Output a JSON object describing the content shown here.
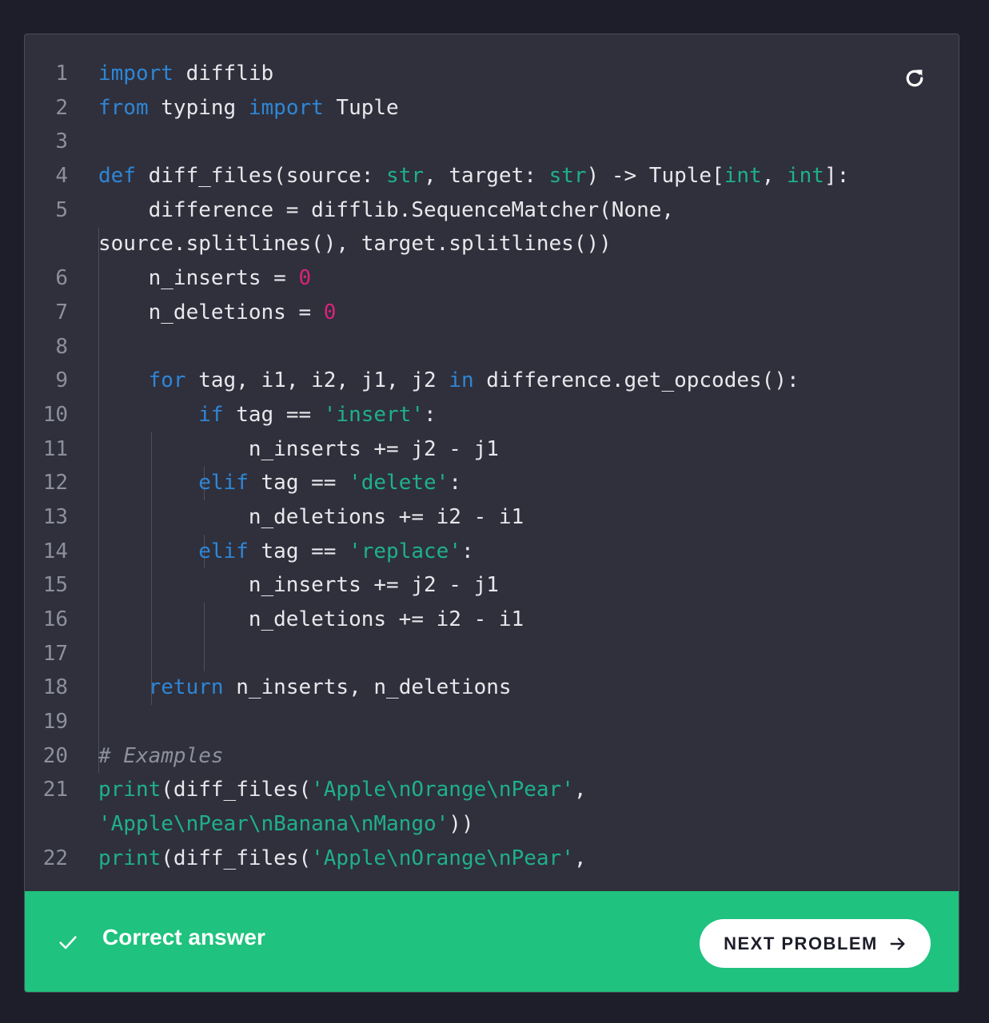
{
  "editor": {
    "line_numbers": [
      "1",
      "2",
      "3",
      "4",
      "5",
      "",
      "6",
      "7",
      "8",
      "9",
      "10",
      "11",
      "12",
      "13",
      "14",
      "15",
      "16",
      "17",
      "18",
      "19",
      "20",
      "21",
      "",
      "22"
    ],
    "reset_icon": "reset-icon"
  },
  "feedback": {
    "status": "Correct answer",
    "status_icon": "check-icon",
    "next_label": "NEXT PROBLEM",
    "next_icon": "arrow-right-icon"
  },
  "colors": {
    "background": "#1d1e2a",
    "panel": "#2f303c",
    "keyword": "#2f86d6",
    "builtin_and_string": "#1fb08a",
    "number": "#d8247a",
    "comment": "#8d8f9c",
    "success": "#1fc27e"
  }
}
